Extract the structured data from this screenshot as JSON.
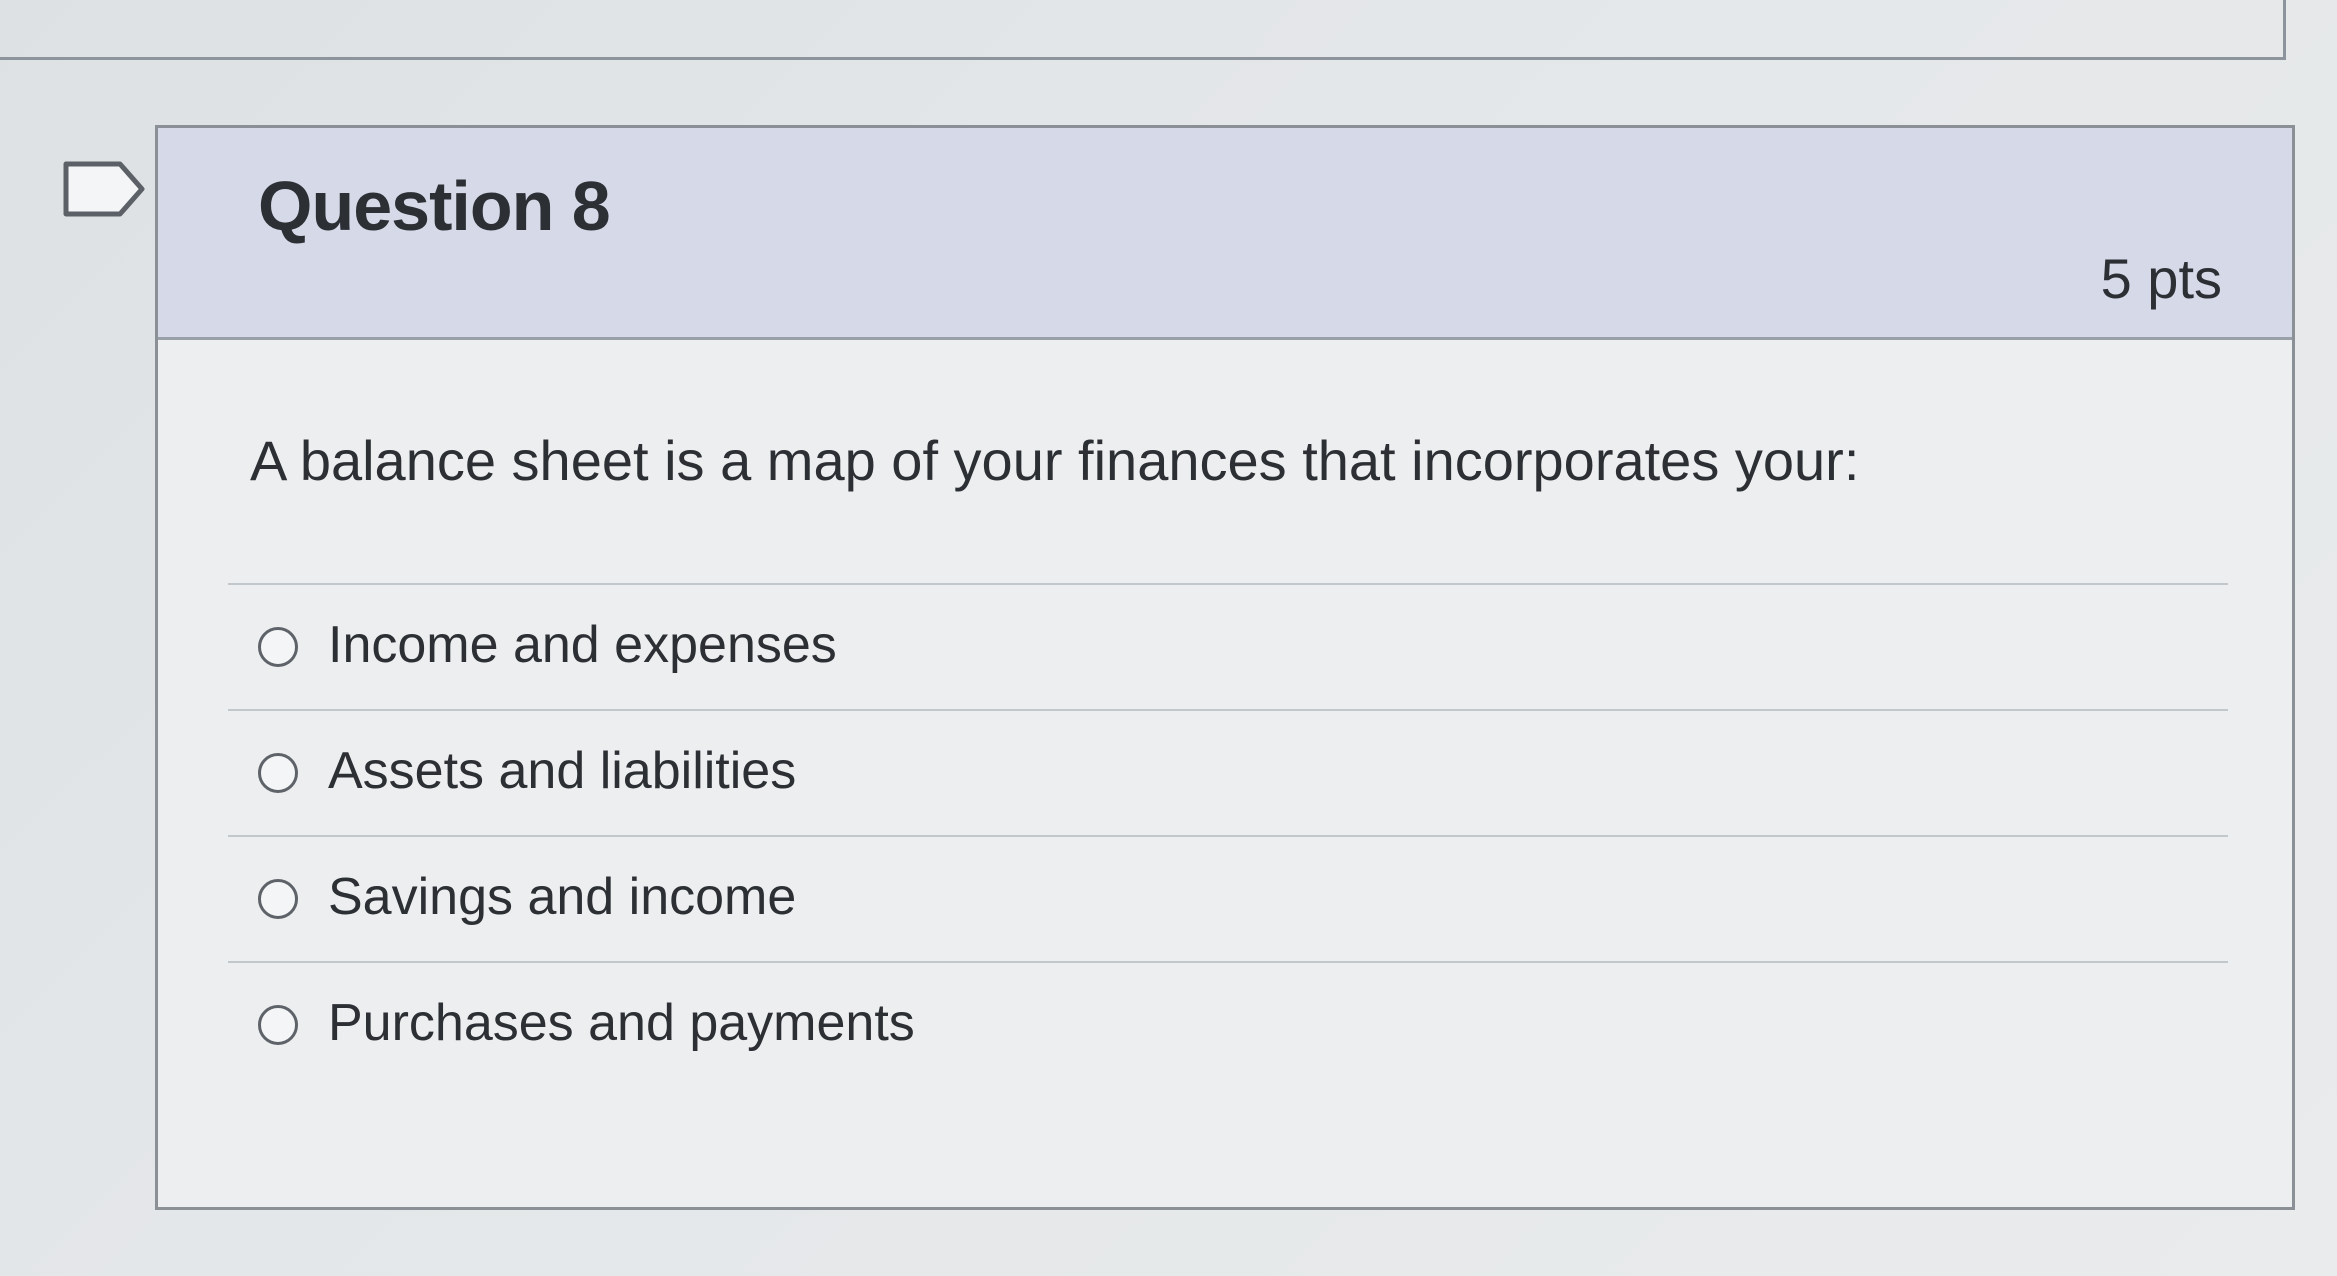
{
  "question": {
    "title": "Question 8",
    "points": "5 pts",
    "text": "A balance sheet is a map of your finances that incorporates your:",
    "flag_icon": "flag-bookmark-icon"
  },
  "answers": [
    {
      "label": "Income and expenses",
      "selected": false
    },
    {
      "label": "Assets and liabilities",
      "selected": false
    },
    {
      "label": "Savings and income",
      "selected": false
    },
    {
      "label": "Purchases and payments",
      "selected": false
    }
  ]
}
